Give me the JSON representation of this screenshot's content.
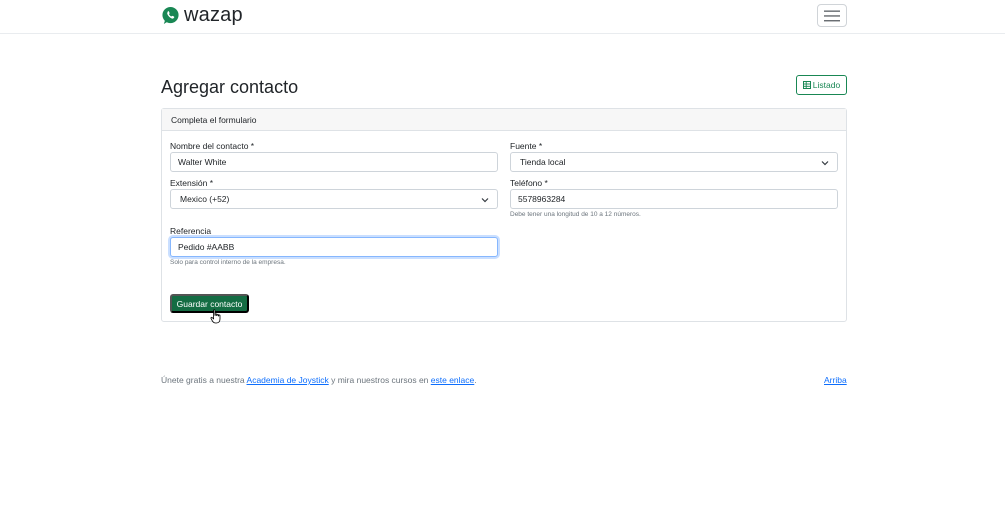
{
  "header": {
    "brand": "wazap"
  },
  "page": {
    "title": "Agregar contacto",
    "list_button": "Listado"
  },
  "card": {
    "header": "Completa el formulario"
  },
  "form": {
    "name": {
      "label": "Nombre del contacto *",
      "value": "Walter White"
    },
    "source": {
      "label": "Fuente *",
      "value": "Tienda local"
    },
    "extension": {
      "label": "Extensión *",
      "value": "Mexico (+52)"
    },
    "phone": {
      "label": "Teléfono *",
      "value": "5578963284",
      "help": "Debe tener una longitud de 10 a 12 números."
    },
    "reference": {
      "label": "Referencia",
      "value": "Pedido #AABB",
      "help": "Solo para control interno de la empresa."
    },
    "submit": "Guardar contacto"
  },
  "footer": {
    "text_1": "Únete gratis a nuestra ",
    "link_1": "Academia de Joystick",
    "text_2": " y mira nuestros cursos en ",
    "link_2": "este enlace",
    "text_3": ".",
    "top_link": "Arriba"
  },
  "colors": {
    "brand_green": "#198754",
    "button_green": "#146c43",
    "link_blue": "#0d6efd",
    "focus_border": "#86b7fe"
  }
}
